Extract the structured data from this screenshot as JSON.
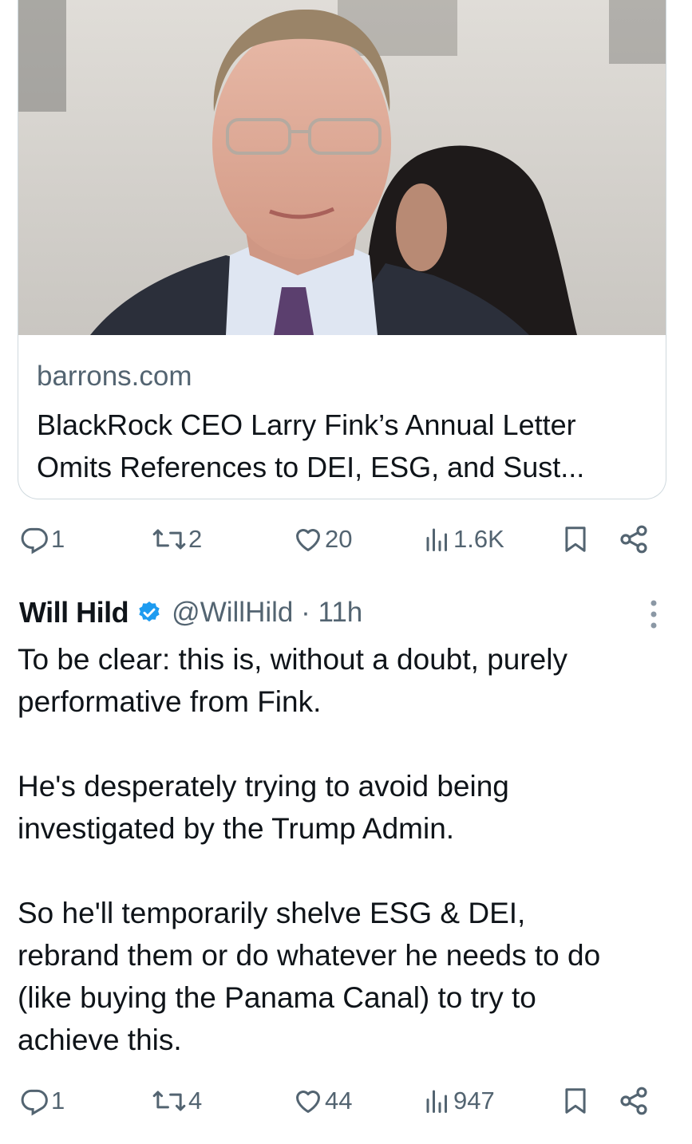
{
  "link_card": {
    "domain": "barrons.com",
    "title_line1": "BlackRock CEO Larry Fink’s Annual Letter",
    "title_line2": "Omits References to DEI, ESG, and Sust..."
  },
  "card_actions": {
    "replies": "1",
    "reposts": "2",
    "likes": "20",
    "views": "1.6K"
  },
  "tweet": {
    "author_name": "Will Hild",
    "handle_time": "@WillHild · 11h",
    "paragraphs": [
      [
        "To be clear: this is, without a doubt, purely",
        "performative from Fink."
      ],
      [
        "He's desperately trying to avoid being",
        "investigated by the Trump Admin."
      ],
      [
        "So he'll temporarily shelve ESG & DEI,",
        "rebrand them or do whatever he needs to do",
        "(like buying the Panama Canal) to try to",
        "achieve this."
      ]
    ]
  },
  "tweet_actions": {
    "replies": "1",
    "reposts": "4",
    "likes": "44",
    "views": "947"
  },
  "colors": {
    "text": "#0f1419",
    "secondary": "#536471",
    "verified": "#1d9bf0",
    "border": "#cfd9de"
  },
  "icons": [
    "reply-icon",
    "repost-icon",
    "like-icon",
    "views-icon",
    "bookmark-icon",
    "share-icon",
    "verified-badge-icon",
    "more-icon"
  ]
}
